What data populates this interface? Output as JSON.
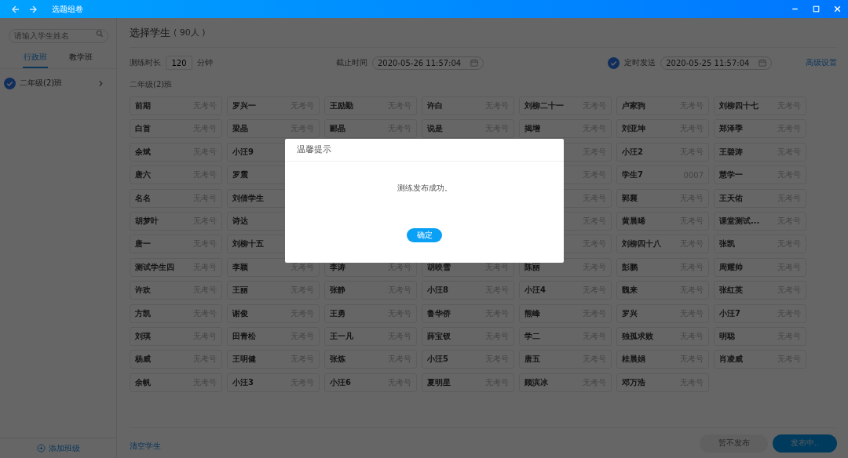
{
  "window": {
    "title": "选题组卷"
  },
  "sidebar": {
    "search": {
      "placeholder": "请输入学生姓名"
    },
    "tabs": [
      {
        "label": "行政班",
        "selected": true
      },
      {
        "label": "教学班",
        "selected": false
      }
    ],
    "classes": [
      {
        "name": "二年级(2)班",
        "checked": true
      }
    ],
    "add_button": "添加班级"
  },
  "header": {
    "title": "选择学生",
    "count": "( 90人 )"
  },
  "settings": {
    "duration_label": "测练时长",
    "duration": "120",
    "duration_unit": "分钟",
    "deadline_label": "截止时间",
    "deadline": "2020-05-26 11:57:04",
    "scheduled": {
      "label": "定时发送",
      "checked": true
    },
    "schedule_time": "2020-05-25 11:57:04",
    "advanced_link": "高级设置"
  },
  "group_label": "二年级(2)班",
  "student_rows": [
    {
      "cards": [
        {
          "name": "前期",
          "exam_no": "无考号"
        },
        {
          "name": "罗兴一",
          "exam_no": "无考号"
        },
        {
          "name": "王励勤",
          "exam_no": "无考号"
        },
        {
          "name": "许白",
          "exam_no": "无考号"
        },
        {
          "name": "刘柳二十一",
          "exam_no": "无考号"
        },
        {
          "name": "卢家驹",
          "exam_no": "无考号"
        },
        {
          "name": "刘柳四十七",
          "exam_no": "无考号"
        }
      ]
    },
    {
      "cards": [
        {
          "name": "白首",
          "exam_no": "无考号"
        },
        {
          "name": "梁晶",
          "exam_no": "无考号"
        },
        {
          "name": "郦晶",
          "exam_no": "无考号"
        },
        {
          "name": "说是",
          "exam_no": "无考号"
        },
        {
          "name": "揭增",
          "exam_no": "无考号"
        },
        {
          "name": "刘亚坤",
          "exam_no": "无考号"
        },
        {
          "name": "郑泽季",
          "exam_no": "无考号"
        }
      ]
    },
    {
      "left": [
        {
          "name": "余斌",
          "exam_no": "无考号"
        },
        {
          "name": "小汪9"
        }
      ],
      "right": [
        {
          "exam_no": "无考号"
        },
        {
          "name": "小汪2",
          "exam_no": "无考号"
        },
        {
          "name": "王碧涛",
          "exam_no": "无考号"
        }
      ]
    },
    {
      "left": [
        {
          "name": "唐六",
          "exam_no": "无考号"
        },
        {
          "name": "罗震"
        }
      ],
      "right": [
        {
          "exam_no": "无考号"
        },
        {
          "name": "学生7",
          "exam_no": "0007"
        },
        {
          "name": "慧学一",
          "exam_no": "无考号"
        }
      ]
    },
    {
      "left": [
        {
          "name": "名名",
          "exam_no": "无考号"
        },
        {
          "name": "刘倩学生"
        }
      ],
      "right": [
        {
          "exam_no": "无考号"
        },
        {
          "name": "郭襄",
          "exam_no": "无考号"
        },
        {
          "name": "王天佑",
          "exam_no": "无考号"
        }
      ]
    },
    {
      "left": [
        {
          "name": "胡梦叶",
          "exam_no": "无考号"
        },
        {
          "name": "诗达"
        }
      ],
      "right": [
        {
          "exam_no": "无考号"
        },
        {
          "name": "黄晨晞",
          "exam_no": "无考号"
        },
        {
          "name": "课堂测试...",
          "exam_no": "无考号"
        }
      ]
    },
    {
      "left": [
        {
          "name": "唐一",
          "exam_no": "无考号"
        },
        {
          "name": "刘柳十五"
        }
      ],
      "right": [
        {
          "exam_no": "无考号"
        },
        {
          "name": "刘柳四十八",
          "exam_no": "无考号"
        },
        {
          "name": "张凯",
          "exam_no": "无考号"
        }
      ]
    },
    {
      "cards": [
        {
          "name": "测试学生四",
          "exam_no": "无考号"
        },
        {
          "name": "李颖",
          "exam_no": "无考号"
        },
        {
          "name": "李涛",
          "exam_no": "无考号"
        },
        {
          "name": "胡映雪",
          "exam_no": "无考号"
        },
        {
          "name": "陈丽",
          "exam_no": "无考号"
        },
        {
          "name": "彭鹏",
          "exam_no": "无考号"
        },
        {
          "name": "周耀帅",
          "exam_no": "无考号"
        }
      ]
    },
    {
      "cards": [
        {
          "name": "许欢",
          "exam_no": "无考号"
        },
        {
          "name": "王丽",
          "exam_no": "无考号"
        },
        {
          "name": "张静",
          "exam_no": "无考号"
        },
        {
          "name": "小汪8",
          "exam_no": "无考号"
        },
        {
          "name": "小汪4",
          "exam_no": "无考号"
        },
        {
          "name": "魏来",
          "exam_no": "无考号"
        },
        {
          "name": "张红英",
          "exam_no": "无考号"
        }
      ]
    },
    {
      "cards": [
        {
          "name": "方凯",
          "exam_no": "无考号"
        },
        {
          "name": "谢俊",
          "exam_no": "无考号"
        },
        {
          "name": "王勇",
          "exam_no": "无考号"
        },
        {
          "name": "鲁华侨",
          "exam_no": "无考号"
        },
        {
          "name": "熊峰",
          "exam_no": "无考号"
        },
        {
          "name": "罗兴",
          "exam_no": "无考号"
        },
        {
          "name": "小汪7",
          "exam_no": "无考号"
        }
      ]
    },
    {
      "cards": [
        {
          "name": "刘琪",
          "exam_no": "无考号"
        },
        {
          "name": "田青松",
          "exam_no": "无考号"
        },
        {
          "name": "王一凡",
          "exam_no": "无考号"
        },
        {
          "name": "薛宝钗",
          "exam_no": "无考号"
        },
        {
          "name": "学二",
          "exam_no": "无考号"
        },
        {
          "name": "独孤求败",
          "exam_no": "无考号"
        },
        {
          "name": "明聪",
          "exam_no": "无考号"
        }
      ]
    },
    {
      "cards": [
        {
          "name": "杨威",
          "exam_no": "无考号"
        },
        {
          "name": "王明健",
          "exam_no": "无考号"
        },
        {
          "name": "张炼",
          "exam_no": "无考号"
        },
        {
          "name": "小汪5",
          "exam_no": "无考号"
        },
        {
          "name": "唐五",
          "exam_no": "无考号"
        },
        {
          "name": "桂晨娟",
          "exam_no": "无考号"
        },
        {
          "name": "肖凌威",
          "exam_no": "无考号"
        }
      ]
    },
    {
      "cards": [
        {
          "name": "余帆",
          "exam_no": "无考号"
        },
        {
          "name": "小汪3",
          "exam_no": "无考号"
        },
        {
          "name": "小汪6",
          "exam_no": "无考号"
        },
        {
          "name": "夏明星",
          "exam_no": "无考号"
        },
        {
          "name": "顾滨冰",
          "exam_no": "无考号"
        },
        {
          "name": "邓万浩",
          "exam_no": "无考号"
        }
      ]
    }
  ],
  "footer": {
    "clear_link": "清空学生",
    "buttons": [
      {
        "label": "暂不发布",
        "kind": "secondary"
      },
      {
        "label": "发布中..",
        "kind": "primary"
      }
    ]
  },
  "dialog": {
    "title": "温馨提示",
    "message": "测练发布成功。",
    "button": "确定"
  }
}
